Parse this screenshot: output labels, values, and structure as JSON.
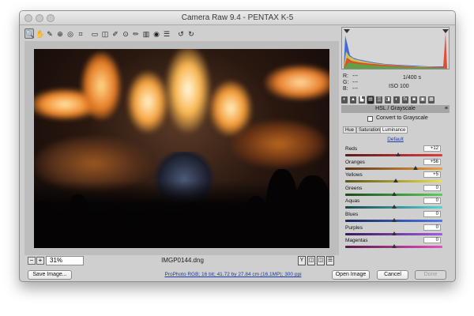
{
  "window": {
    "title": "Camera Raw 9.4  -  PENTAX K-5"
  },
  "toolbar": {
    "tools": [
      {
        "name": "zoom-tool-icon",
        "glyph": "🔍",
        "active": true
      },
      {
        "name": "hand-tool-icon",
        "glyph": "✋",
        "active": false
      },
      {
        "name": "white-balance-tool-icon",
        "glyph": "✎",
        "active": false
      },
      {
        "name": "color-sampler-tool-icon",
        "glyph": "⊕",
        "active": false
      },
      {
        "name": "targeted-adjustment-tool-icon",
        "glyph": "◎",
        "active": false
      },
      {
        "name": "crop-tool-icon",
        "glyph": "⌗",
        "active": false
      },
      {
        "name": "straighten-tool-icon",
        "glyph": "▭",
        "active": false
      },
      {
        "name": "transform-tool-icon",
        "glyph": "◫",
        "active": false
      },
      {
        "name": "spot-removal-tool-icon",
        "glyph": "✐",
        "active": false
      },
      {
        "name": "red-eye-tool-icon",
        "glyph": "⊙",
        "active": false
      },
      {
        "name": "adjustment-brush-icon",
        "glyph": "✏",
        "active": false
      },
      {
        "name": "graduated-filter-icon",
        "glyph": "▥",
        "active": false
      },
      {
        "name": "radial-filter-icon",
        "glyph": "◉",
        "active": false
      },
      {
        "name": "preferences-icon",
        "glyph": "☰",
        "active": false
      },
      {
        "name": "rotate-left-icon",
        "glyph": "↺",
        "active": false
      },
      {
        "name": "rotate-right-icon",
        "glyph": "↻",
        "active": false
      }
    ],
    "panel_toggle_glyph": "⤢"
  },
  "status": {
    "zoom_out": "−",
    "zoom_in": "+",
    "zoom": "31%",
    "filename": "IMGP0144.dng",
    "view_buttons": [
      "Y",
      "◫",
      "◫",
      "☰"
    ]
  },
  "readout": {
    "r_label": "R:",
    "r_value": "---",
    "g_label": "G:",
    "g_value": "---",
    "b_label": "B:",
    "b_value": "---",
    "shutter": "1/400 s",
    "iso": "ISO 100"
  },
  "panel": {
    "tab_icons": [
      "◐",
      "▲",
      "▙",
      "▤",
      "▒",
      "◨",
      "◐",
      "fx",
      "◙",
      "▣",
      "▦"
    ],
    "title": "HSL / Grayscale",
    "menu_glyph": "≡",
    "grayscale_label": "Convert to Grayscale",
    "subtabs": [
      "Hue",
      "Saturation",
      "Luminance"
    ],
    "active_subtab": 2,
    "default_link": "Default"
  },
  "sliders": [
    {
      "label": "Reds",
      "value": "+12",
      "pos": 0.547,
      "track": "linear-gradient(90deg,#5b1b1b,#e23b3b)"
    },
    {
      "label": "Oranges",
      "value": "+56",
      "pos": 0.72,
      "track": "linear-gradient(90deg,#5b3414,#f0a040)"
    },
    {
      "label": "Yellows",
      "value": "+5",
      "pos": 0.52,
      "track": "linear-gradient(90deg,#5b5514,#efe04a)"
    },
    {
      "label": "Greens",
      "value": "0",
      "pos": 0.5,
      "track": "linear-gradient(90deg,#1c4a1c,#5ad05a)"
    },
    {
      "label": "Aquas",
      "value": "0",
      "pos": 0.5,
      "track": "linear-gradient(90deg,#14474a,#57d6d6)"
    },
    {
      "label": "Blues",
      "value": "0",
      "pos": 0.5,
      "track": "linear-gradient(90deg,#18285a,#4f78e6)"
    },
    {
      "label": "Purples",
      "value": "0",
      "pos": 0.5,
      "track": "linear-gradient(90deg,#3a1a5a,#a45ae0)"
    },
    {
      "label": "Magentas",
      "value": "0",
      "pos": 0.5,
      "track": "linear-gradient(90deg,#5a1848,#e050c0)"
    }
  ],
  "buttons": {
    "save": "Save Image...",
    "open": "Open Image",
    "cancel": "Cancel",
    "done": "Done"
  },
  "workflow_link": "ProPhoto RGB; 16 bit; 41.72 by 27.84 cm (16.1MP); 300 ppi"
}
